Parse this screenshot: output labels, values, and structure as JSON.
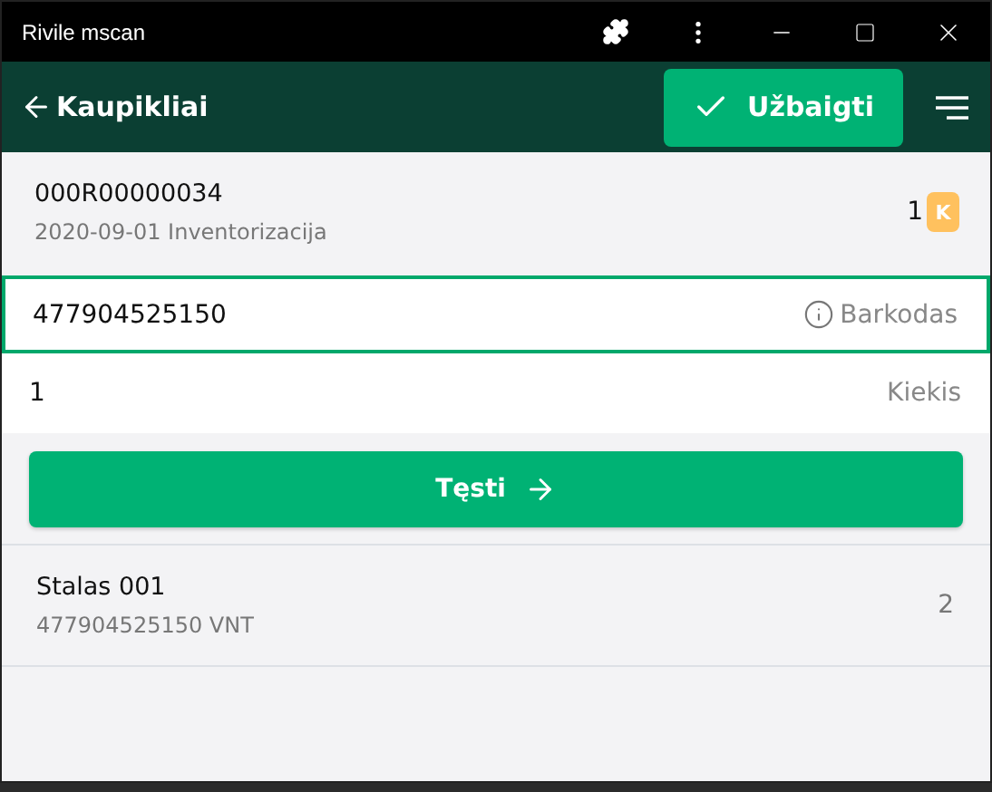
{
  "window": {
    "title": "Rivile mscan"
  },
  "header": {
    "title": "Kaupikliai",
    "action": "Užbaigti"
  },
  "document": {
    "number": "000R00000034",
    "subtitle": "2020-09-01 Inventorizacija",
    "count": "1",
    "badge": "K"
  },
  "barcode_field": {
    "value": "477904525150",
    "label": "Barkodas",
    "focused": true
  },
  "quantity_field": {
    "value": "1",
    "label": "Kiekis",
    "focused": false
  },
  "continue_button": "Tęsti",
  "items": [
    {
      "name": "Stalas 001",
      "detail": "477904525150 VNT",
      "quantity": "2"
    }
  ]
}
